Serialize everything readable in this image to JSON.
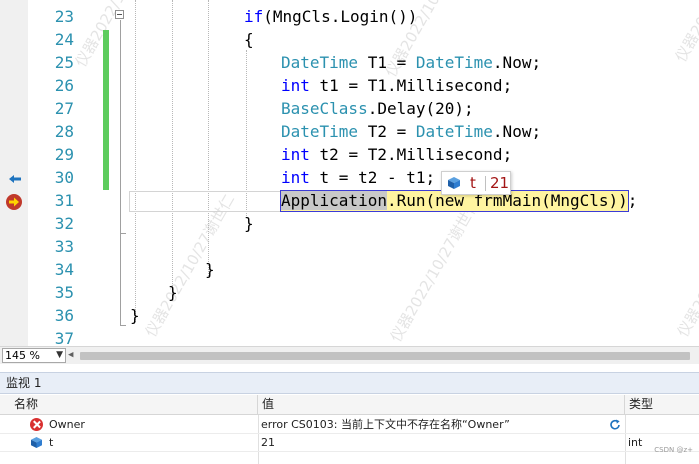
{
  "editor": {
    "line_numbers": [
      "23",
      "24",
      "25",
      "26",
      "27",
      "28",
      "29",
      "30",
      "31",
      "32",
      "33",
      "34",
      "35",
      "36",
      "37"
    ],
    "lines": {
      "l23": {
        "kw": "if",
        "rest": "(MngCls.Login())"
      },
      "l24": {
        "text": "{"
      },
      "l25": {
        "type": "DateTime",
        "mid": " T1 = ",
        "type2": "DateTime",
        "rest": ".Now;"
      },
      "l26": {
        "kw": "int",
        "rest": " t1 = T1.Millisecond;"
      },
      "l27": {
        "type": "BaseClass",
        "rest": ".Delay(20);"
      },
      "l28": {
        "type": "DateTime",
        "mid": " T2 = ",
        "type2": "DateTime",
        "rest": ".Now;"
      },
      "l29": {
        "kw": "int",
        "rest": " t2 = T2.Millisecond;"
      },
      "l30": {
        "kw": "int",
        "rest": " t = t2 - t1;"
      },
      "l31": {
        "app": "Application",
        "rest": ".Run(new frmMain(MngCls));"
      },
      "l32": {
        "text": "}"
      },
      "l34": {
        "text": "}"
      },
      "l35": {
        "text": "}"
      },
      "l36": {
        "text": "}"
      }
    },
    "datatip": {
      "name": "t",
      "value": "21"
    },
    "watermark": "仪器2022/10/27谢世仁"
  },
  "zoom": {
    "level": "145 %"
  },
  "watch": {
    "title": "监视 1",
    "columns": {
      "name": "名称",
      "value": "值",
      "type": "类型"
    },
    "rows": [
      {
        "name": "Owner",
        "value": "error CS0103: 当前上下文中不存在名称“Owner”",
        "type": ""
      },
      {
        "name": "t",
        "value": "21",
        "type": "int"
      }
    ],
    "credit": "CSDN @z+"
  },
  "colors": {
    "keyword": "#0000ff",
    "type": "#2b91af",
    "line_number": "#2b91af",
    "change_bar": "#5dcc5d",
    "current_statement": "#fff4a0",
    "error": "#d93030"
  }
}
